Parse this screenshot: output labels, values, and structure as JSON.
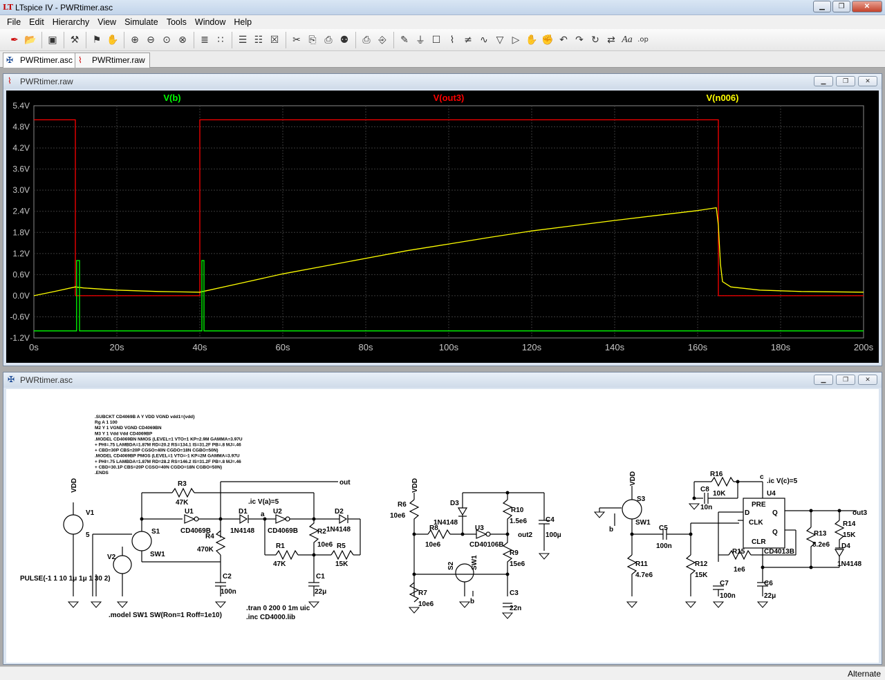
{
  "app": {
    "title": "LTspice IV - PWRtimer.asc",
    "logo": "LT"
  },
  "menu": [
    "File",
    "Edit",
    "Hierarchy",
    "View",
    "Simulate",
    "Tools",
    "Window",
    "Help"
  ],
  "toolbar_icons": [
    "new-schematic-icon",
    "open-icon",
    "save-icon",
    "control-panel-icon",
    "run-icon",
    "halt-icon",
    "zoom-in-icon",
    "zoom-out-icon",
    "zoom-fit-icon",
    "zoom-cancel-icon",
    "autorange-icon",
    "grid-icon",
    "tile-horizontal-icon",
    "cascade-icon",
    "close-all-icon",
    "cut-icon",
    "copy-icon",
    "paste-icon",
    "find-icon",
    "print-setup-icon",
    "print-icon",
    "wire-icon",
    "ground-icon",
    "label-icon",
    "resistor-icon",
    "capacitor-icon",
    "inductor-icon",
    "diode-icon",
    "component-icon",
    "move-icon",
    "drag-icon",
    "undo-icon",
    "redo-icon",
    "rotate-icon",
    "mirror-icon",
    "text-icon",
    "spice-directive-icon"
  ],
  "tabs": [
    {
      "label": "PWRtimer.asc"
    },
    {
      "label": "PWRtimer.raw"
    }
  ],
  "plot_window": {
    "title": "PWRtimer.raw"
  },
  "schematic_window": {
    "title": "PWRtimer.asc"
  },
  "status": {
    "mode": "Alternate"
  },
  "colors": {
    "vb": "#00ff00",
    "vout3": "#ff0000",
    "vn006": "#ffff00",
    "plot_bg": "#000000",
    "grid": "#3a3a3a",
    "axis_text": "#c8c8c8"
  },
  "chart_data": {
    "type": "line",
    "xlabel": "",
    "ylabel": "",
    "xlim": [
      0,
      200
    ],
    "ylim": [
      -1.2,
      5.4
    ],
    "x_ticks": [
      "0s",
      "20s",
      "40s",
      "60s",
      "80s",
      "100s",
      "120s",
      "140s",
      "160s",
      "180s",
      "200s"
    ],
    "y_ticks": [
      "5.4V",
      "4.8V",
      "4.2V",
      "3.6V",
      "3.0V",
      "2.4V",
      "1.8V",
      "1.2V",
      "0.6V",
      "0.0V",
      "-0.6V",
      "-1.2V"
    ],
    "grid": true,
    "series": [
      {
        "name": "V(b)",
        "x": [
          0,
          10.3,
          10.3,
          11,
          11,
          40.5,
          40.5,
          41,
          41,
          200
        ],
        "y": [
          -1.0,
          -1.0,
          1.0,
          1.0,
          -1.0,
          -1.0,
          1.0,
          1.0,
          -1.0,
          -1.0
        ]
      },
      {
        "name": "V(out3)",
        "x": [
          0,
          10,
          10,
          40,
          40,
          165,
          165,
          200
        ],
        "y": [
          5.0,
          5.0,
          0.0,
          0.0,
          5.0,
          5.0,
          0.0,
          0.0
        ]
      },
      {
        "name": "V(n006)",
        "x": [
          0,
          5,
          10,
          12,
          20,
          30,
          40,
          50,
          60,
          70,
          80,
          90,
          100,
          110,
          120,
          130,
          140,
          150,
          160,
          164.5,
          165,
          165.5,
          166,
          168,
          175,
          185,
          200
        ],
        "y": [
          0.0,
          0.12,
          0.25,
          0.22,
          0.16,
          0.12,
          0.1,
          0.36,
          0.62,
          0.84,
          1.06,
          1.28,
          1.47,
          1.66,
          1.84,
          1.99,
          2.14,
          2.28,
          2.42,
          2.5,
          2.0,
          0.9,
          0.4,
          0.25,
          0.16,
          0.12,
          0.1
        ]
      }
    ]
  },
  "schematic": {
    "spice_model": [
      ".SUBCKT CD4069B  A Y  VDD VGND  vdd1={vdd}",
      "  Rg  A 1 100",
      "M2 Y 1 VGND VGND CD4069BN",
      "M3 Y 1 Vdd Vdd CD4069BP",
      ".MODEL CD4069BN NMOS (LEVEL=1 VTO=1 KP=2.9M GAMMA=3.97U",
      "+ PHI=.75 LAMBDA=1.87M RD=20.2 RS=134.1 IS=31.2F PB=.8 MJ=.46",
      "+ CBD=30P CBS=20P CGSO=40N CGDO=18N CGBO=50N)",
      ".MODEL CD4069BP PMOS (LEVEL=1 VTO=-1 KP=2M GAMMA=3.97U",
      "+ PHI=.75 LAMBDA=1.87M RD=28.2 RS=146.2 IS=31.2F PB=.8 MJ=.46",
      "+ CBD=30.1P CBS=20P CGSO=40N CGDO=18N CGBO=50N)",
      ".ENDS"
    ],
    "labels": {
      "vdd": "VDD",
      "v1": "V1",
      "v1val": "5",
      "v2": "V2",
      "pulse": "PULSE(-1 1 10 1μ 1μ 1 30 2)",
      "s1": "S1",
      "sw1": "SW1",
      "r3": "R3",
      "r3v": "47K",
      "u1": "U1",
      "u1v": "CD4069B",
      "d1": "D1",
      "d1v": "1N4148",
      "ic_a": ".ic V(a)=5",
      "a": "a",
      "u2": "U2",
      "u2v": "CD4069B",
      "d2": "D2",
      "d2v": "1N4148",
      "out": "out",
      "r4": "R4",
      "r4v": "470K",
      "r2": "R2",
      "r2v": "10e6",
      "r1": "R1",
      "r1v": "47K",
      "r5": "R5",
      "r5v": "15K",
      "c2": "C2",
      "c2v": "100n",
      "c1": "C1",
      "c1v": "22μ",
      "model_sw": ".model SW1 SW(Ron=1 Roff=1e10)",
      "tran": ".tran 0 200 0 1m uic",
      "inc": ".inc CD4000.lib",
      "r6": "R6",
      "r6v": "10e6",
      "d3": "D3",
      "d3v": "1N4148",
      "r10": "R10",
      "r10v": "1.5e6",
      "c4": "C4",
      "c4v": "100μ",
      "r8": "R8",
      "r8v": "10e6",
      "u3": "U3",
      "u3v": "CD40106B",
      "out2": "out2",
      "r9": "R9",
      "r9v": "15e6",
      "s2": "S2",
      "r7": "R7",
      "r7v": "10e6",
      "c3": "C3",
      "c3v": "22n",
      "b": "b",
      "s3": "S3",
      "c5": "C5",
      "c5v": "100n",
      "r11": "R11",
      "r11v": "4.7e6",
      "r12": "R12",
      "r12v": "15K",
      "r16": "R16",
      "r16v": "10K",
      "c8": "C8",
      "c8v": "10n",
      "c": "c",
      "ic_c": ".ic V(c)=5",
      "u4": "U4",
      "pre": "PRE",
      "d": "D",
      "q": "Q",
      "clk": "CLK",
      "qbar": "Q",
      "clr": "CLR",
      "u4v": "CD4013B",
      "out3": "out3",
      "r13": "R13",
      "r13v": "8.2e6",
      "r14": "R14",
      "r14v": "15K",
      "d4": "D4",
      "d4v": "1N4148",
      "r15": "R15",
      "r15v": "1e6",
      "c7": "C7",
      "c7v": "100n",
      "c6": "C6",
      "c6v": "22μ"
    }
  }
}
